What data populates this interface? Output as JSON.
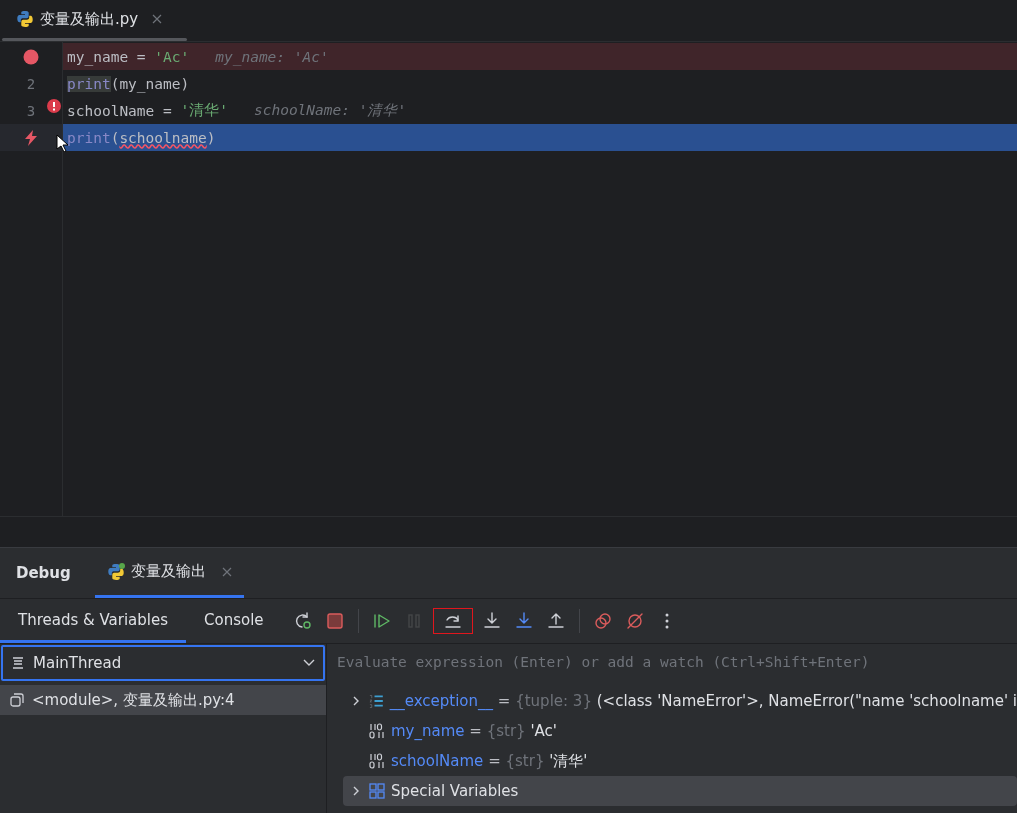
{
  "editor_tab": {
    "title": "变量及输出.py"
  },
  "code_lines": [
    {
      "breakpoint": true,
      "current": false,
      "error_mark": false,
      "tokens": [
        {
          "kind": "plain",
          "text": "my_name = "
        },
        {
          "kind": "string",
          "text": "'Ac'"
        }
      ],
      "hint": "my_name: 'Ac'"
    },
    {
      "breakpoint": false,
      "current": false,
      "error_mark": false,
      "line_number": "2",
      "tokens": [
        {
          "kind": "func_marked",
          "text": "print"
        },
        {
          "kind": "plain",
          "text": "(my_name)"
        }
      ]
    },
    {
      "breakpoint": false,
      "current": false,
      "error_mark": true,
      "line_number": "3",
      "tokens": [
        {
          "kind": "plain",
          "text": "schoolName = "
        },
        {
          "kind": "string",
          "text": "'清华'"
        }
      ],
      "hint": "schoolName: '清华'"
    },
    {
      "breakpoint": false,
      "current": true,
      "error_mark": false,
      "tokens": [
        {
          "kind": "func",
          "text": "print"
        },
        {
          "kind": "plain",
          "text": "("
        },
        {
          "kind": "error",
          "text": "schoolname"
        },
        {
          "kind": "plain",
          "text": ")"
        }
      ]
    }
  ],
  "debug": {
    "title": "Debug",
    "tabs": [
      {
        "label": "变量及输出",
        "selected": true
      }
    ],
    "subtabs": [
      {
        "label": "Threads & Variables",
        "selected": true
      },
      {
        "label": "Console",
        "selected": false
      }
    ],
    "toolbar_groups": [
      {
        "buttons": [
          {
            "kind": "rerun",
            "disabled": false,
            "highlighted": false
          },
          {
            "kind": "stop",
            "disabled": false,
            "highlighted": false
          }
        ]
      },
      {
        "buttons": [
          {
            "kind": "resume",
            "disabled": false,
            "highlighted": false
          },
          {
            "kind": "pause",
            "disabled": true,
            "highlighted": false
          },
          {
            "kind": "step_over",
            "disabled": false,
            "highlighted": true
          },
          {
            "kind": "step_into",
            "disabled": false,
            "highlighted": false
          },
          {
            "kind": "step_into_my_code",
            "disabled": false,
            "highlighted": false
          },
          {
            "kind": "step_out",
            "disabled": false,
            "highlighted": false
          }
        ]
      },
      {
        "buttons": [
          {
            "kind": "view_breakpoints",
            "disabled": false,
            "highlighted": false
          },
          {
            "kind": "mute_breakpoints",
            "disabled": false,
            "highlighted": false
          },
          {
            "kind": "more",
            "disabled": false,
            "highlighted": false
          }
        ]
      }
    ],
    "thread_select": {
      "value": "MainThread"
    },
    "frames": [
      {
        "label": "<module>, 变量及输出.py:4",
        "selected": true
      }
    ],
    "evaluate_field": {
      "placeholder": "Evaluate expression (Enter) or add a watch (Ctrl+Shift+Enter)"
    },
    "variables": [
      {
        "kind": "exception",
        "name": "__exception__",
        "separator": "=",
        "type": "{tuple: 3}",
        "value": "(<class 'NameError'>, NameError(\"name 'schoolname' i",
        "expanded": false,
        "selected": false
      },
      {
        "kind": "str",
        "name": "my_name",
        "separator": "=",
        "type": "{str}",
        "value": "'Ac'",
        "selected": false
      },
      {
        "kind": "str",
        "name": "schoolName",
        "separator": "=",
        "type": "{str}",
        "value": "'清华'",
        "selected": false
      },
      {
        "kind": "special",
        "name": "Special Variables",
        "selected": true,
        "expanded": false
      }
    ]
  }
}
